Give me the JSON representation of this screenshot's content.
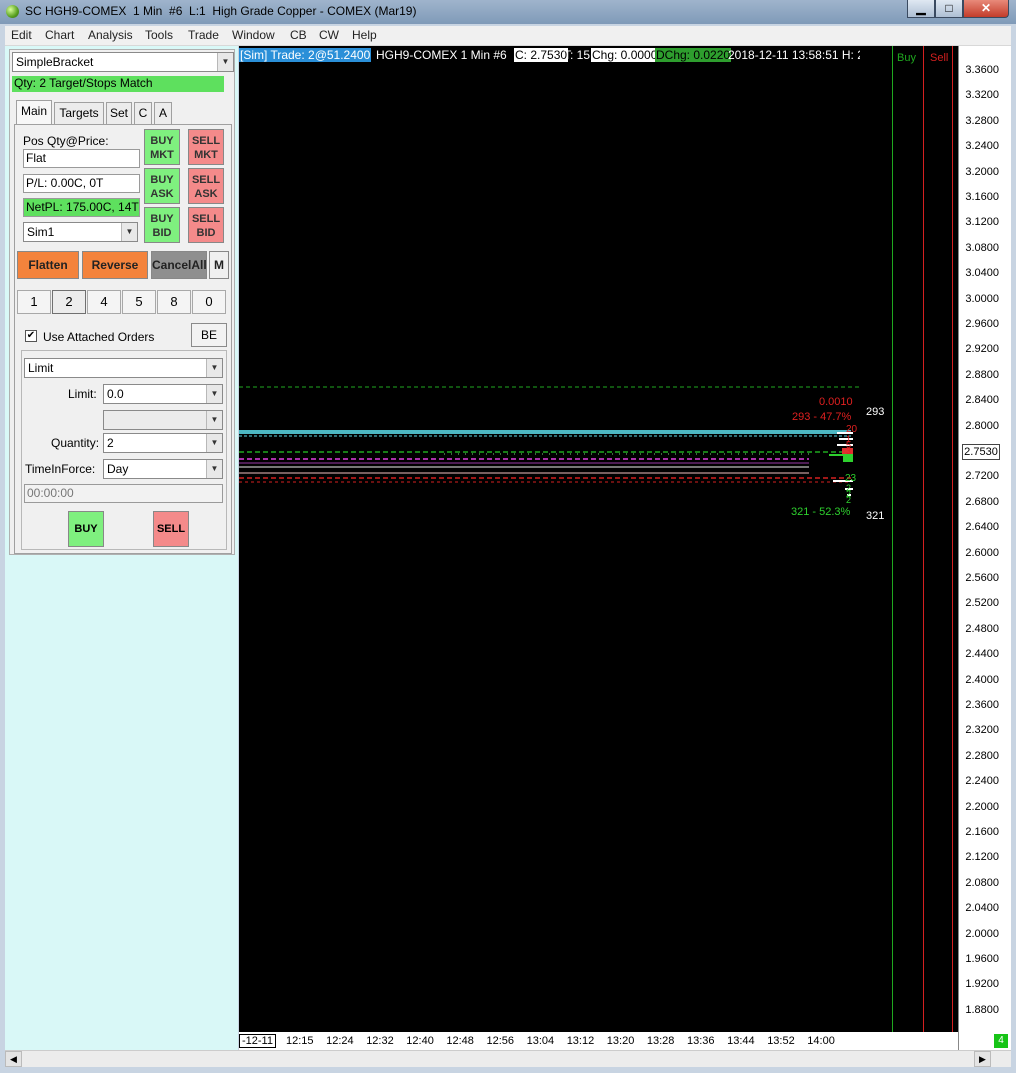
{
  "window": {
    "title": "SC HGH9-COMEX  1 Min  #6  L:1  High Grade Copper - COMEX (Mar19)",
    "min": "▁",
    "max": "□",
    "close": "✕"
  },
  "menu": [
    "Edit",
    "Chart",
    "Analysis",
    "Tools",
    "Trade",
    "Window",
    "CB",
    "CW",
    "Help"
  ],
  "panel": {
    "strategy": "SimpleBracket",
    "status": "Qty: 2 Target/Stops Match",
    "tabs": [
      "Main",
      "Targets",
      "Set",
      "C",
      "A"
    ],
    "pos_label": "Pos Qty@Price:",
    "pos_value": "Flat",
    "pl_value": "P/L: 0.00C, 0T",
    "netpl_value": "NetPL: 175.00C, 14T",
    "account": "Sim1",
    "buy_mkt": "BUY\nMKT",
    "sell_mkt": "SELL\nMKT",
    "buy_ask": "BUY\nASK",
    "sell_ask": "SELL\nASK",
    "buy_bid": "BUY\nBID",
    "sell_bid": "SELL\nBID",
    "flatten": "Flatten",
    "reverse": "Reverse",
    "cancel_all": "CancelAll",
    "m": "M",
    "quantities": [
      "1",
      "2",
      "4",
      "5",
      "8",
      "0"
    ],
    "use_attached": "Use Attached Orders",
    "check": "✔",
    "be": "BE",
    "order_type": "Limit",
    "limit_label": "Limit:",
    "limit_value": "0.0",
    "quantity_label": "Quantity:",
    "quantity_value": "2",
    "tif_label": "TimeInForce:",
    "tif_value": "Day",
    "time_value": "00:00:00",
    "buy": "BUY",
    "sell": "SELL"
  },
  "chart": {
    "header": {
      "sim": "[Sim]  Trade: 2@51.2400",
      "symbol": "HGH9-COMEX  1 Min  #6",
      "close": "C: 2.7530",
      "ticks": "T: 15",
      "chg": "Chg: 0.0000",
      "dchg": "DChg: 0.0220",
      "datetime": "2018-12-11  13:58:51  H: 2."
    },
    "buy_label": "Buy",
    "sell_label": "Sell",
    "annotations": {
      "top_value": "0.0010",
      "ask_summary": "293 - 47.7%",
      "bid_summary": "321 - 52.3%",
      "ask_total": "293",
      "bid_total": "321",
      "ask_stack": [
        "20",
        "1",
        "5",
        "3"
      ],
      "bid_stack": [
        "23",
        "2",
        "2",
        "2"
      ]
    },
    "colors": {
      "green_line": "#1fa81f",
      "red_line": "#d42020",
      "cyan_level": "#5ad8e6",
      "magenta_level": "#e040e0"
    },
    "current_price": "2.7530",
    "price_labels": [
      "3.3600",
      "3.3200",
      "3.2800",
      "3.2400",
      "3.2000",
      "3.1600",
      "3.1200",
      "3.0800",
      "3.0400",
      "3.0000",
      "2.9600",
      "2.9200",
      "2.8800",
      "2.8400",
      "2.8000",
      "2.7600",
      "2.7200",
      "2.6800",
      "2.6400",
      "2.6000",
      "2.5600",
      "2.5200",
      "2.4800",
      "2.4400",
      "2.4000",
      "2.3600",
      "2.3200",
      "2.2800",
      "2.2400",
      "2.2000",
      "2.1600",
      "2.1200",
      "2.0800",
      "2.0400",
      "2.0000",
      "1.9600",
      "1.9200",
      "1.8800"
    ],
    "time_start": "-12-11",
    "time_labels": [
      "12:15",
      "12:24",
      "12:32",
      "12:40",
      "12:48",
      "12:56",
      "13:04",
      "13:12",
      "13:20",
      "13:28",
      "13:36",
      "13:44",
      "13:52",
      "14:00"
    ],
    "status_badge": "4"
  }
}
